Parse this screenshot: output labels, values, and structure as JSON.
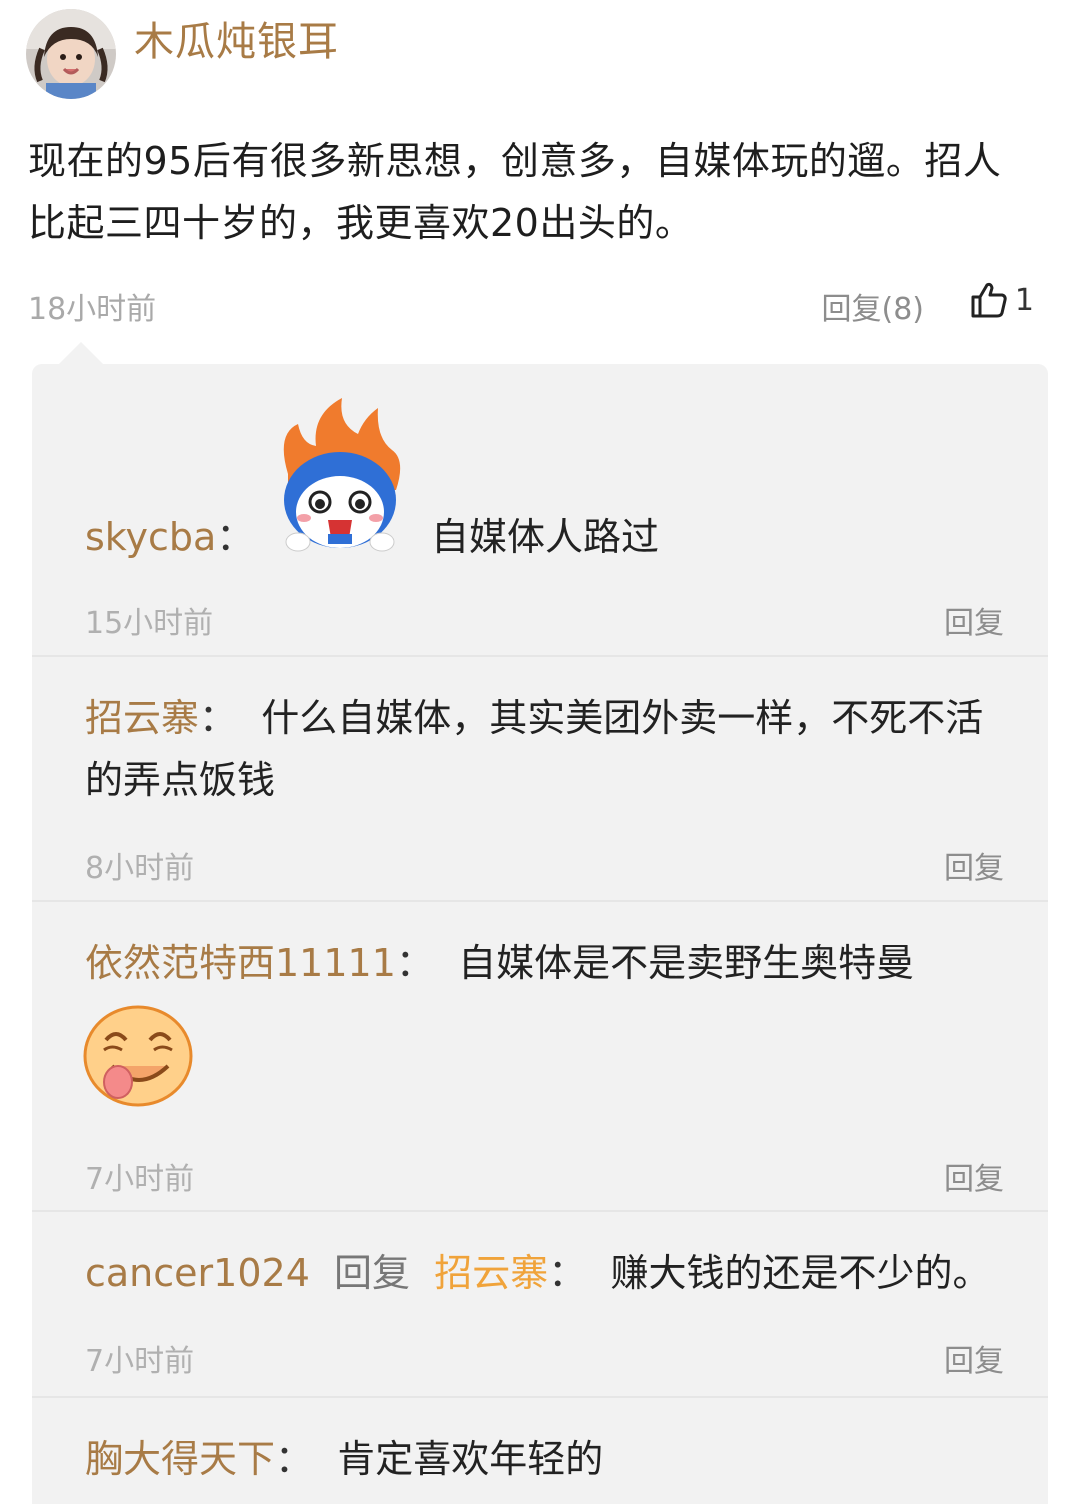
{
  "post": {
    "username": "木瓜炖银耳",
    "avatar_icon": "child-photo-avatar",
    "text": "现在的95后有很多新思想，创意多，自媒体玩的遛。招人比起三四十岁的，我更喜欢20出头的。",
    "time": "18小时前",
    "reply_label": "回复(8)",
    "like_count": "1",
    "like_icon": "thumbs-up-icon"
  },
  "comments": [
    {
      "user": "skycba",
      "colon": "：",
      "emoji": "fire-head-shocked-emoji",
      "text": "自媒体人路过",
      "time": "15小时前",
      "reply": "回复"
    },
    {
      "user": "招云寨",
      "colon": "：",
      "text": "什么自媒体，其实美团外卖一样，不死不活的弄点饭钱",
      "time": "8小时前",
      "reply": "回复"
    },
    {
      "user": "依然范特西11111",
      "colon": "：",
      "text": "自媒体是不是卖野生奥特曼",
      "emoji": "laughing-tongue-emoji",
      "time": "7小时前",
      "reply": "回复"
    },
    {
      "user": "cancer1024",
      "reply_word": "回复",
      "target": "招云寨",
      "colon": "：",
      "text": "赚大钱的还是不少的。",
      "time": "7小时前",
      "reply": "回复"
    },
    {
      "user": "胸大得天下",
      "colon": "：",
      "text": "肯定喜欢年轻的"
    }
  ],
  "colors": {
    "username": "#a87b46",
    "highlight_username": "#f0a33a",
    "panel_bg": "#f2f2f2"
  }
}
